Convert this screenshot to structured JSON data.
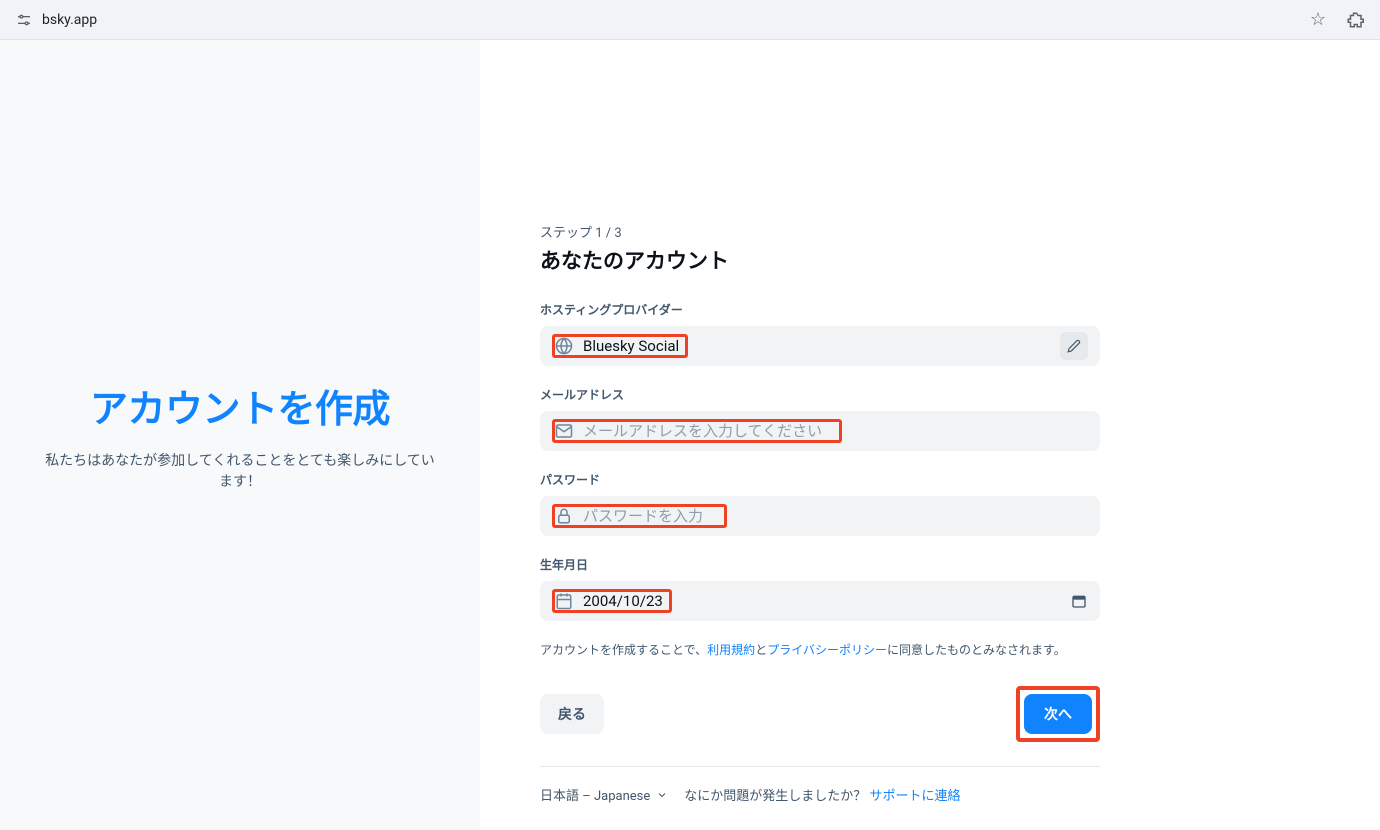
{
  "browser": {
    "url": "bsky.app"
  },
  "left": {
    "title": "アカウントを作成",
    "subtitle": "私たちはあなたが参加してくれることをとても楽しみにしています！"
  },
  "form": {
    "step": "ステップ 1 / 3",
    "heading": "あなたのアカウント",
    "hosting": {
      "label": "ホスティングプロバイダー",
      "value": "Bluesky Social"
    },
    "email": {
      "label": "メールアドレス",
      "placeholder": "メールアドレスを入力してください"
    },
    "password": {
      "label": "パスワード",
      "placeholder": "パスワードを入力"
    },
    "birthdate": {
      "label": "生年月日",
      "value": "2004/10/23"
    },
    "terms": {
      "prefix": "アカウントを作成することで、",
      "tos": "利用規約",
      "and": "と",
      "privacy": "プライバシーポリシー",
      "suffix": "に同意したものとみなされます。"
    },
    "buttons": {
      "back": "戻る",
      "next": "次へ"
    }
  },
  "footer": {
    "language": "日本語 – Japanese",
    "support_prompt": "なにか問題が発生しましたか？",
    "support_link": "サポートに連絡"
  }
}
